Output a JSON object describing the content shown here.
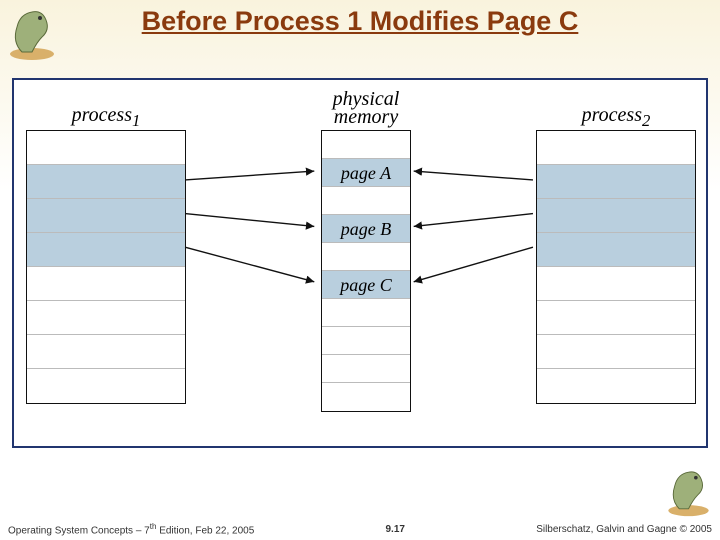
{
  "title": "Before Process 1 Modifies Page C",
  "columns": {
    "process1_label": "process",
    "process1_sub": "1",
    "memory_label_line1": "physical",
    "memory_label_line2": "memory",
    "process2_label": "process",
    "process2_sub": "2"
  },
  "memory_pages": {
    "pageA": "page A",
    "pageB": "page B",
    "pageC": "page C"
  },
  "footer": {
    "left_prefix": "Operating System Concepts – 7",
    "left_sup": "th",
    "left_suffix": " Edition, Feb 22, 2005",
    "slide_number": "9.17",
    "right": "Silberschatz, Galvin and Gagne © 2005"
  },
  "diagram_semantics": {
    "description": "Copy-on-write before modification: process1 and process2 both map to shared physical pages A, B, C.",
    "mappings": [
      {
        "from": "process1",
        "slot": 1,
        "to": "page A"
      },
      {
        "from": "process1",
        "slot": 2,
        "to": "page B"
      },
      {
        "from": "process1",
        "slot": 3,
        "to": "page C"
      },
      {
        "from": "process2",
        "slot": 1,
        "to": "page A"
      },
      {
        "from": "process2",
        "slot": 2,
        "to": "page B"
      },
      {
        "from": "process2",
        "slot": 3,
        "to": "page C"
      }
    ]
  }
}
